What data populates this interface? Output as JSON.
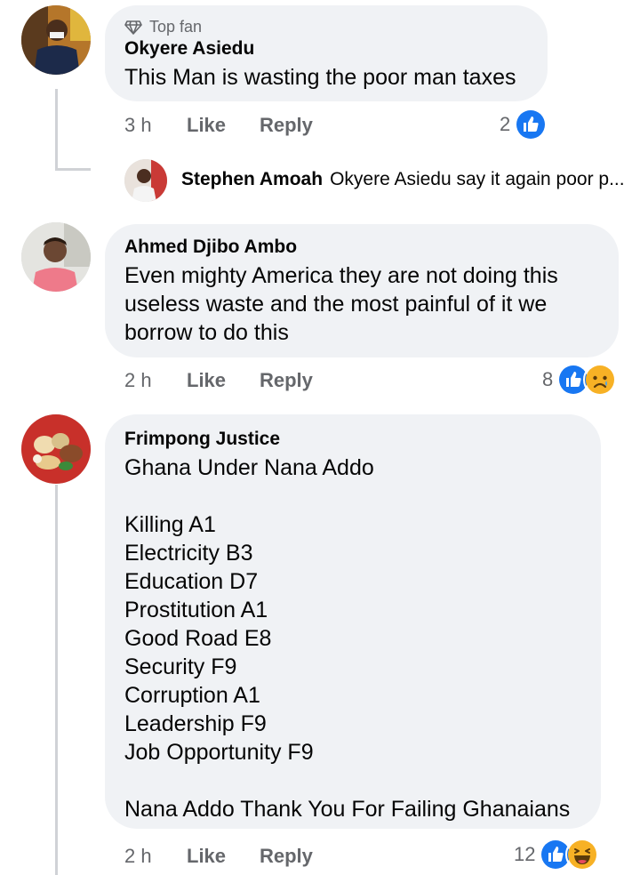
{
  "comments": [
    {
      "badge": "Top fan",
      "author": "Okyere Asiedu",
      "text": "This Man is wasting the poor man taxes",
      "time": "3 h",
      "like_label": "Like",
      "reply_label": "Reply",
      "reaction_count": "2",
      "reactions": [
        "like-icon"
      ],
      "reply": {
        "author": "Stephen Amoah",
        "text": "Okyere Asiedu say it again poor p..."
      }
    },
    {
      "author": "Ahmed Djibo Ambo",
      "text": "Even mighty America they are not doing this\nuseless waste and the most painful of it we\nborrow to do this",
      "time": "2 h",
      "like_label": "Like",
      "reply_label": "Reply",
      "reaction_count": "8",
      "reactions": [
        "like-icon",
        "sad-icon"
      ]
    },
    {
      "author": "Frimpong Justice",
      "text": "Ghana Under Nana Addo\n\nKilling  A1\nElectricity  B3\nEducation  D7\nProstitution  A1\nGood Road  E8\nSecurity  F9\nCorruption  A1\nLeadership  F9\nJob Opportunity  F9\n\nNana Addo Thank You For Failing Ghanaians",
      "time": "2 h",
      "like_label": "Like",
      "reply_label": "Reply",
      "reaction_count": "12",
      "reactions": [
        "like-icon",
        "haha-icon"
      ]
    }
  ],
  "colors": {
    "like_blue": "#1877f2",
    "bubble_bg": "#f0f2f5",
    "secondary_text": "#65676b",
    "emoji_yellow": "#f7b125"
  }
}
